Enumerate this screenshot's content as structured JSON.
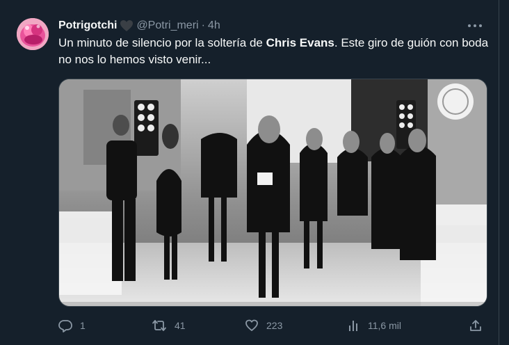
{
  "tweet": {
    "display_name": "Potrigotchi",
    "handle": "@Potri_meri",
    "separator": "·",
    "time": "4h",
    "text_before": "Un minuto de silencio por la soltería de ",
    "text_bold": "Chris Evans",
    "text_after": ". Este giro de guión con boda no nos lo hemos visto venir...",
    "media_icon": "photo",
    "icons": {
      "badge": "heart-icon",
      "more": "more-icon",
      "reply": "reply-icon",
      "retweet": "retweet-icon",
      "like": "like-icon",
      "views": "views-icon",
      "share": "share-icon"
    }
  },
  "actions": {
    "replies": "1",
    "retweets": "41",
    "likes": "223",
    "views": "11,6 mil"
  },
  "colors": {
    "background": "#15202b",
    "text": "#f7f9f9",
    "secondary": "#8b98a5",
    "border": "#38444d"
  }
}
